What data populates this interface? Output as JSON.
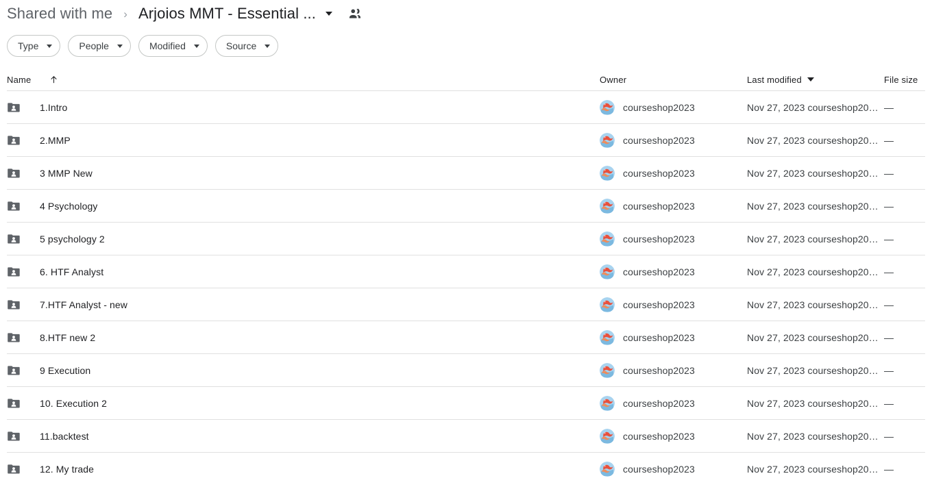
{
  "breadcrumb": {
    "parent": "Shared with me",
    "separator": "›",
    "current": "Arjoios MMT - Essential ...",
    "caret_icon": "chevron-down-icon",
    "share_icon": "people-shared-icon"
  },
  "filters": [
    {
      "label": "Type"
    },
    {
      "label": "People"
    },
    {
      "label": "Modified"
    },
    {
      "label": "Source"
    }
  ],
  "table": {
    "headers": {
      "name": "Name",
      "name_sort_icon": "arrow-up-icon",
      "owner": "Owner",
      "last_modified": "Last modified",
      "last_modified_caret": "chevron-down-icon",
      "file_size": "File size"
    },
    "rows": [
      {
        "name": "1.Intro",
        "icon": "shared-folder-icon",
        "owner": "courseshop2023",
        "modified": "Nov 27, 2023 courseshop20…",
        "size": "—"
      },
      {
        "name": "2.MMP",
        "icon": "shared-folder-icon",
        "owner": "courseshop2023",
        "modified": "Nov 27, 2023 courseshop20…",
        "size": "—"
      },
      {
        "name": "3 MMP New",
        "icon": "shared-folder-icon",
        "owner": "courseshop2023",
        "modified": "Nov 27, 2023 courseshop20…",
        "size": "—"
      },
      {
        "name": "4 Psychology",
        "icon": "shared-folder-icon",
        "owner": "courseshop2023",
        "modified": "Nov 27, 2023 courseshop20…",
        "size": "—"
      },
      {
        "name": "5 psychology 2",
        "icon": "shared-folder-icon",
        "owner": "courseshop2023",
        "modified": "Nov 27, 2023 courseshop20…",
        "size": "—"
      },
      {
        "name": "6. HTF Analyst",
        "icon": "shared-folder-icon",
        "owner": "courseshop2023",
        "modified": "Nov 27, 2023 courseshop20…",
        "size": "—"
      },
      {
        "name": "7.HTF Analyst - new",
        "icon": "shared-folder-icon",
        "owner": "courseshop2023",
        "modified": "Nov 27, 2023 courseshop20…",
        "size": "—"
      },
      {
        "name": "8.HTF new 2",
        "icon": "shared-folder-icon",
        "owner": "courseshop2023",
        "modified": "Nov 27, 2023 courseshop20…",
        "size": "—"
      },
      {
        "name": "9 Execution",
        "icon": "shared-folder-icon",
        "owner": "courseshop2023",
        "modified": "Nov 27, 2023 courseshop20…",
        "size": "—"
      },
      {
        "name": "10. Execution 2",
        "icon": "shared-folder-icon",
        "owner": "courseshop2023",
        "modified": "Nov 27, 2023 courseshop20…",
        "size": "—"
      },
      {
        "name": "11.backtest",
        "icon": "shared-folder-icon",
        "owner": "courseshop2023",
        "modified": "Nov 27, 2023 courseshop20…",
        "size": "—"
      },
      {
        "name": "12. My trade",
        "icon": "shared-folder-icon",
        "owner": "courseshop2023",
        "modified": "Nov 27, 2023 courseshop20…",
        "size": "—"
      }
    ]
  },
  "colors": {
    "folder_icon": "#5f6368",
    "divider": "#e0e0e0",
    "text_primary": "#202124",
    "text_secondary": "#5f6368",
    "chip_border": "#c4c7c5",
    "avatar_background": "#a8d3ef",
    "avatar_accent": "#e8513d"
  }
}
